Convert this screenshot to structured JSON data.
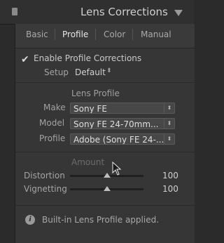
{
  "header": {
    "title": "Lens Corrections"
  },
  "tabs": [
    {
      "label": "Basic"
    },
    {
      "label": "Profile"
    },
    {
      "label": "Color"
    },
    {
      "label": "Manual"
    }
  ],
  "profile": {
    "enable_label": "Enable Profile Corrections",
    "enable_checked": "✔",
    "setup_label": "Setup",
    "setup_value": "Default",
    "lens_profile_heading": "Lens Profile",
    "fields": [
      {
        "label": "Make",
        "value": "Sony FE"
      },
      {
        "label": "Model",
        "value": "Sony FE 24-70mm..."
      },
      {
        "label": "Profile",
        "value": "Adobe (Sony FE 24-..."
      }
    ],
    "amount_heading": "Amount",
    "sliders": [
      {
        "label": "Distortion",
        "value": "100",
        "level": 100
      },
      {
        "label": "Vignetting",
        "value": "100",
        "level": 100
      }
    ],
    "info_text": "Built-in Lens Profile applied."
  },
  "icons": {
    "panel_grip": "panel-grip-icon",
    "collapse": "triangle-down-icon",
    "stepper": "up-down-arrow-icon",
    "info": "info-icon",
    "cursor": "mouse-cursor-icon"
  }
}
